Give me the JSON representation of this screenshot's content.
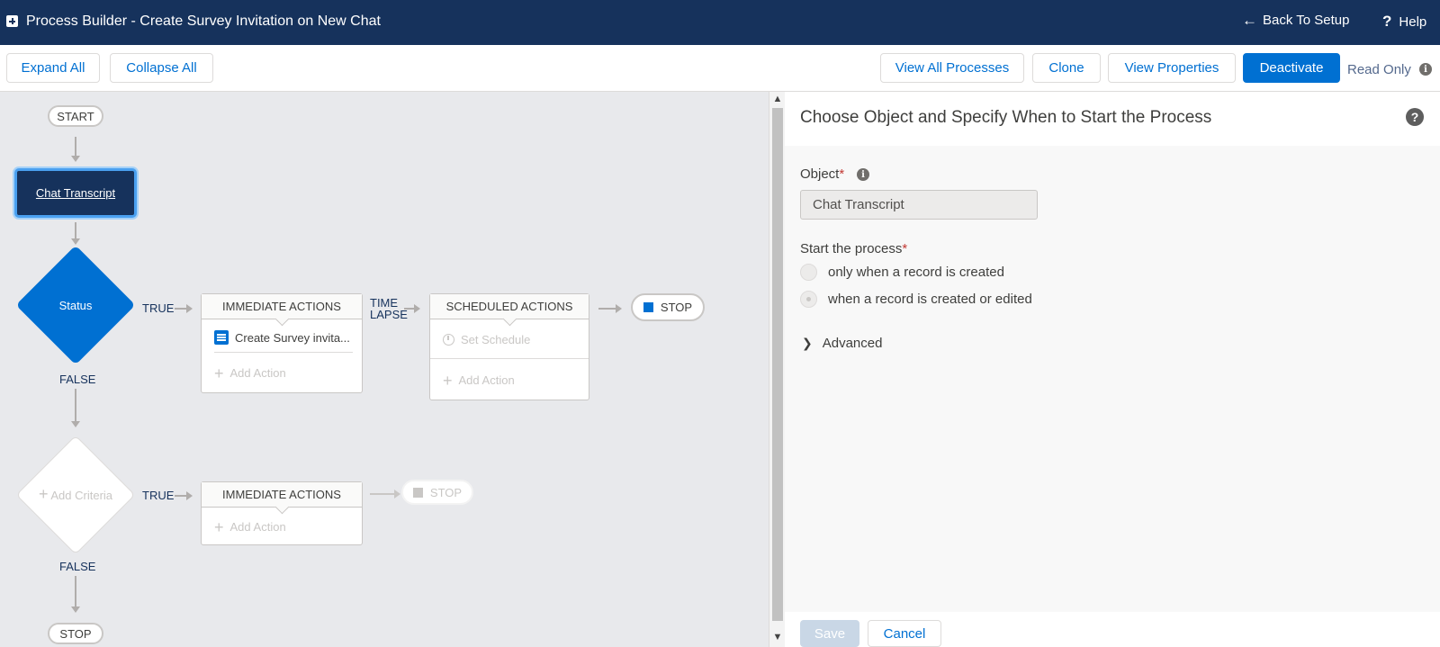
{
  "header": {
    "title": "Process Builder - Create Survey Invitation on New Chat",
    "back_label": "Back To Setup",
    "help_label": "Help"
  },
  "toolbar": {
    "expand_all": "Expand All",
    "collapse_all": "Collapse All",
    "view_all_processes": "View All Processes",
    "clone": "Clone",
    "view_properties": "View Properties",
    "deactivate": "Deactivate",
    "read_only": "Read Only"
  },
  "canvas": {
    "start_label": "START",
    "object_node_label": "Chat Transcript",
    "criteria_1": {
      "label": "Status",
      "true_label": "TRUE",
      "false_label": "FALSE",
      "immediate_header": "IMMEDIATE ACTIONS",
      "action_1": "Create Survey invita...",
      "add_action": "Add Action",
      "time_lapse": [
        "TIME",
        "LAPSE"
      ],
      "scheduled_header": "SCHEDULED ACTIONS",
      "set_schedule": "Set Schedule",
      "add_scheduled_action": "Add Action",
      "stop_label": "STOP"
    },
    "criteria_2": {
      "label": "Add Criteria",
      "true_label": "TRUE",
      "false_label": "FALSE",
      "immediate_header": "IMMEDIATE ACTIONS",
      "add_action": "Add Action",
      "stop_label": "STOP"
    },
    "end_stop_label": "STOP"
  },
  "panel": {
    "title": "Choose Object and Specify When to Start the Process",
    "object_label": "Object",
    "object_value": "Chat Transcript",
    "start_label": "Start the process",
    "options": [
      {
        "label": "only when a record is created",
        "checked": false
      },
      {
        "label": "when a record is created or edited",
        "checked": true
      }
    ],
    "advanced_label": "Advanced",
    "save_label": "Save",
    "cancel_label": "Cancel"
  },
  "colors": {
    "header_bg": "#16325c",
    "brand_blue": "#0070d2",
    "canvas_bg": "#e8e9ec"
  },
  "icons": [
    "app-icon",
    "back-arrow-icon",
    "question-icon",
    "info-icon",
    "list-icon",
    "plus-icon",
    "clock-icon",
    "stop-icon",
    "chevron-right-icon"
  ]
}
